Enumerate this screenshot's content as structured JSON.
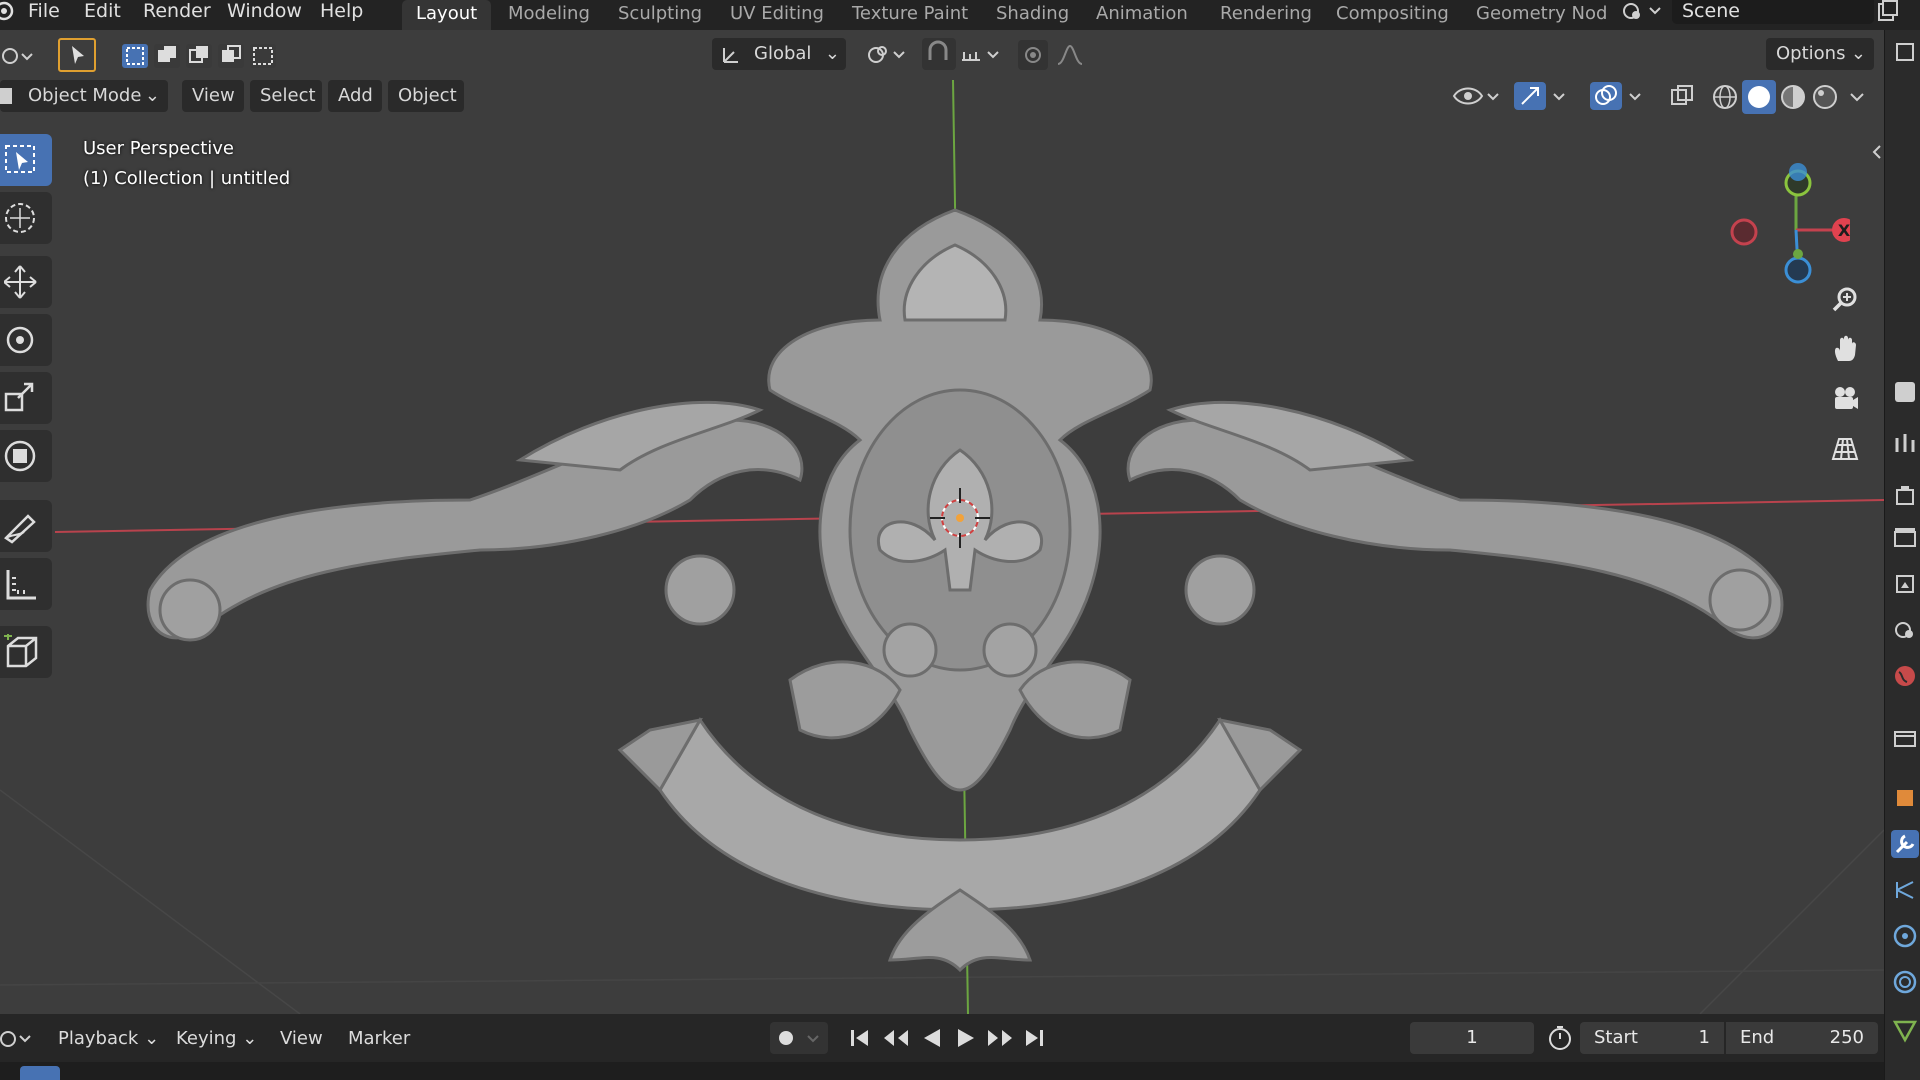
{
  "menu": {
    "items": [
      {
        "label": "File"
      },
      {
        "label": "Edit"
      },
      {
        "label": "Render"
      },
      {
        "label": "Window"
      },
      {
        "label": "Help"
      }
    ]
  },
  "workspaces": {
    "tabs": [
      {
        "label": "Layout",
        "active": true
      },
      {
        "label": "Modeling"
      },
      {
        "label": "Sculpting"
      },
      {
        "label": "UV Editing"
      },
      {
        "label": "Texture Paint"
      },
      {
        "label": "Shading"
      },
      {
        "label": "Animation"
      },
      {
        "label": "Rendering"
      },
      {
        "label": "Compositing"
      },
      {
        "label": "Geometry Nod"
      }
    ]
  },
  "scene": {
    "name": "Scene"
  },
  "toolheader": {
    "orientation": "Global",
    "options_label": "Options"
  },
  "viewport_header": {
    "mode": "Object Mode",
    "menus": [
      "View",
      "Select",
      "Add",
      "Object"
    ]
  },
  "viewport_overlay": {
    "perspective": "User Perspective",
    "collection": "(1) Collection | untitled"
  },
  "gizmo": {
    "x_label": "X",
    "x_color": "#e0424f",
    "y_color": "#8bc43e",
    "z_color": "#3b8fd6"
  },
  "timeline": {
    "menus": [
      "Playback",
      "Keying",
      "View",
      "Marker"
    ],
    "current_frame": "1",
    "start_label": "Start",
    "start_value": "1",
    "end_label": "End",
    "end_value": "250"
  },
  "colors": {
    "accent": "#4772b3",
    "viewport_bg": "#3d3d3d",
    "x_axis": "#c4424e",
    "y_axis": "#6ca641"
  }
}
